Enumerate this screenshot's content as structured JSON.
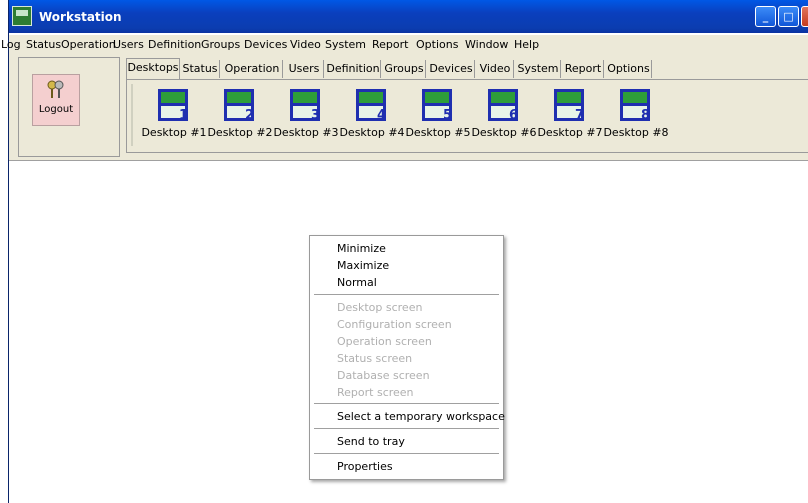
{
  "window": {
    "title": "Workstation"
  },
  "menubar": [
    "Log",
    "Status",
    "Operation",
    "Users",
    "Definition",
    "Groups",
    "Devices",
    "Video",
    "System",
    "Report",
    "Options",
    "Window",
    "Help"
  ],
  "logout": {
    "label": "Logout"
  },
  "tabs": [
    "Desktops",
    "Status",
    "Operation",
    "Users",
    "Definition",
    "Groups",
    "Devices",
    "Video",
    "System",
    "Report",
    "Options"
  ],
  "desktops": [
    {
      "label": "Desktop #1",
      "number": "1"
    },
    {
      "label": "Desktop #2",
      "number": "2"
    },
    {
      "label": "Desktop #3",
      "number": "3"
    },
    {
      "label": "Desktop #4",
      "number": "4"
    },
    {
      "label": "Desktop #5",
      "number": "5"
    },
    {
      "label": "Desktop #6",
      "number": "6"
    },
    {
      "label": "Desktop #7",
      "number": "7"
    },
    {
      "label": "Desktop #8",
      "number": "8"
    }
  ],
  "context_menu": {
    "minimize": "Minimize",
    "maximize": "Maximize",
    "normal": "Normal",
    "desktop_screen": "Desktop screen",
    "configuration_screen": "Configuration screen",
    "operation_screen": "Operation screen",
    "status_screen": "Status screen",
    "database_screen": "Database screen",
    "report_screen": "Report screen",
    "temp_workspace": "Select a temporary workspace",
    "send_to_tray": "Send to tray",
    "properties": "Properties"
  },
  "colors": {
    "titlebar": "#0a3fbd",
    "monitor_green": "#2e9e3a",
    "monitor_blue": "#1f2fb0",
    "logout_bg": "#f4cfcf"
  }
}
